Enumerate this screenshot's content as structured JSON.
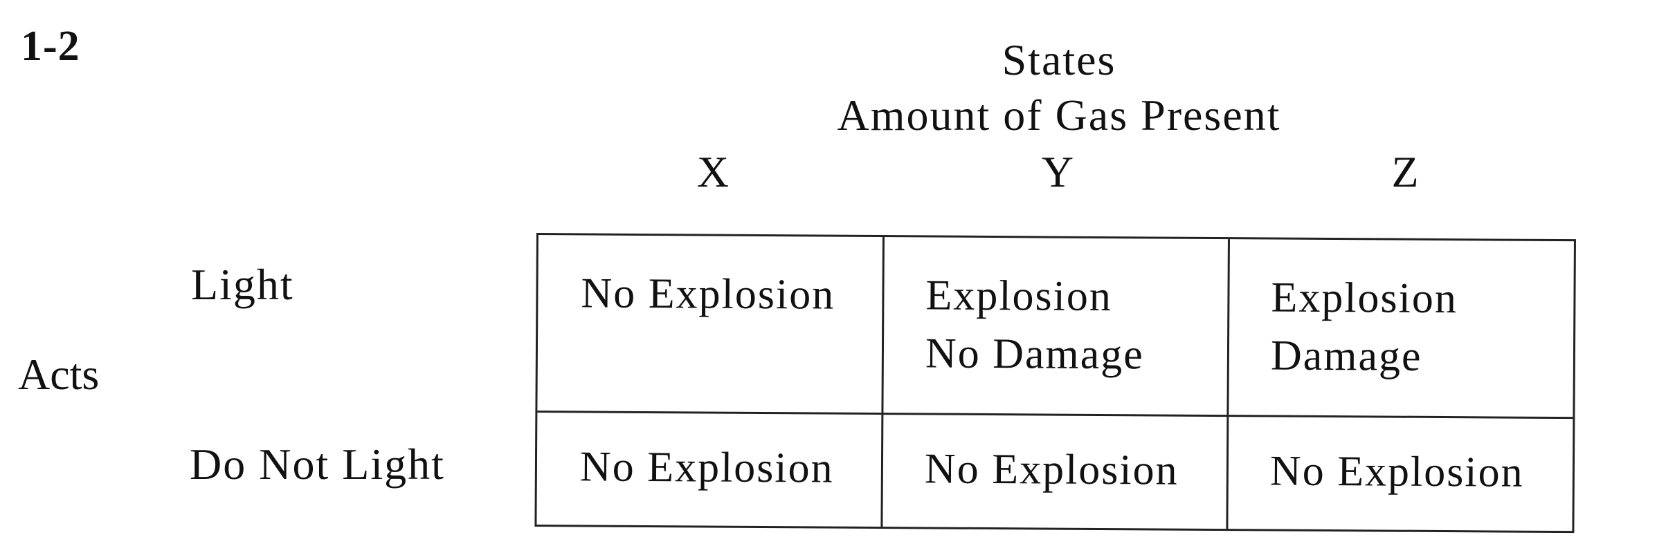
{
  "problem_number": "1-2",
  "states": {
    "title": "States",
    "subtitle": "Amount of Gas Present",
    "columns": [
      "X",
      "Y",
      "Z"
    ]
  },
  "acts_label": "Acts",
  "rows": [
    {
      "label": "Light",
      "cells": [
        [
          "No Explosion"
        ],
        [
          "Explosion",
          "No Damage"
        ],
        [
          "Explosion",
          "Damage"
        ]
      ]
    },
    {
      "label": "Do Not Light",
      "cells": [
        [
          "No Explosion"
        ],
        [
          "No Explosion"
        ],
        [
          "No Explosion"
        ]
      ]
    }
  ]
}
